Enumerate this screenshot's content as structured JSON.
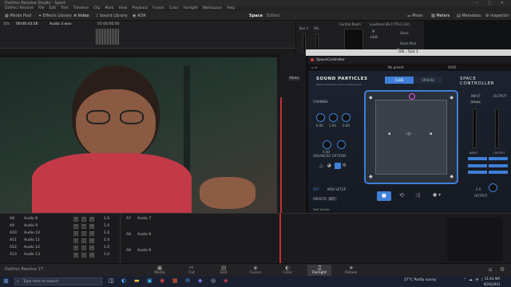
{
  "window": {
    "title": "DaVinci Resolve Studio - Sport"
  },
  "menu": [
    "DaVinci Resolve",
    "File",
    "Edit",
    "Trim",
    "Timeline",
    "Clip",
    "Mark",
    "View",
    "Playback",
    "Fusion",
    "Color",
    "Fairlight",
    "Workspace",
    "Help"
  ],
  "toolbar": {
    "media_pool": "Media Pool",
    "effects_library": "Effects Library",
    "index": "Index",
    "sound_library": "Sound Library",
    "adr": "ADR",
    "project_name": "Space",
    "edited": "Edited",
    "mixer": "Mixer",
    "meters": "Meters",
    "metadata": "Metadata",
    "inspector": "Inspector"
  },
  "timeline": {
    "track_label": "10s",
    "timecode": "00:00:43:26",
    "clip_name": "Audio 3.wav",
    "ruler_time": "01:00:00:00"
  },
  "mixer_panel": {
    "bus1": "Bus 1",
    "dm": "Dlk",
    "m": "M",
    "value1": "+0.0",
    "control_room": "Control Room",
    "loudness": "Loudness",
    "loudness_std": "BS.1770-1 (LU)",
    "short": "Short",
    "short_max": "Short Max",
    "m2": "M"
  },
  "plugin_window": {
    "title": "Dlk - Slot 1",
    "header_title": "SpaceController",
    "preset_label": "No preset",
    "save_label": "SAVE"
  },
  "plugin": {
    "brand": "SOUND PARTICLES",
    "brand_sub": "Space Controller 3d sound Movement",
    "product": "SPACE CONTROLLER",
    "tab_cube": "CUBE",
    "tab_sphere": "SPHERE",
    "channel_label": "CHANNEL",
    "input_label": "INPUT",
    "output_label": "OUTPUT",
    "stereo_label": "Stereo",
    "advanced_options": "ADVANCED OPTIONS",
    "remote_label": "REMOTE",
    "mode_off": "OFF",
    "midi_setup": "MIDI SETUP",
    "trial_label": "Trial Version",
    "output_knob_label": "OUTPUT",
    "output_value": "0.0",
    "knob_values": [
      "0.00",
      "1.00",
      "0.00",
      "0.00"
    ]
  },
  "other_timeline": {
    "mute": "Mute"
  },
  "tracks": [
    {
      "id": "A8",
      "name": "Audio 8"
    },
    {
      "id": "A9",
      "name": "Audio 9"
    },
    {
      "id": "A10",
      "name": "Audio 10"
    },
    {
      "id": "A11",
      "name": "Audio 11"
    },
    {
      "id": "A12",
      "name": "Audio 12"
    },
    {
      "id": "A13",
      "name": "Audio 13"
    }
  ],
  "mid_tracks": [
    {
      "id": "A7",
      "name": "Audio 7"
    },
    {
      "id": "A8",
      "name": "Audio 8"
    },
    {
      "id": "A9",
      "name": "Audio 9"
    }
  ],
  "track_value": "1.0",
  "pages": [
    {
      "label": "Media",
      "icon": "media-icon",
      "glyph": "▣"
    },
    {
      "label": "Cut",
      "icon": "cut-icon",
      "glyph": "✂"
    },
    {
      "label": "Edit",
      "icon": "edit-icon",
      "glyph": "▤"
    },
    {
      "label": "Fusion",
      "icon": "fusion-icon",
      "glyph": "◈"
    },
    {
      "label": "Color",
      "icon": "color-icon",
      "glyph": "◐"
    },
    {
      "label": "Fairlight",
      "icon": "fairlight-icon",
      "glyph": "♫"
    },
    {
      "label": "Deliver",
      "icon": "deliver-icon",
      "glyph": "➤"
    }
  ],
  "app_footer": {
    "name": "DaVinci Resolve 17"
  },
  "taskbar": {
    "search_placeholder": "Type here to search",
    "weather": "27°C  Partly sunny",
    "time": "11:43 AM",
    "date": "8/26/2021"
  },
  "colors": {
    "accent": "#3f7fd8",
    "plugin_bg": "#1c2330",
    "active_page": "#3a3a3c"
  }
}
